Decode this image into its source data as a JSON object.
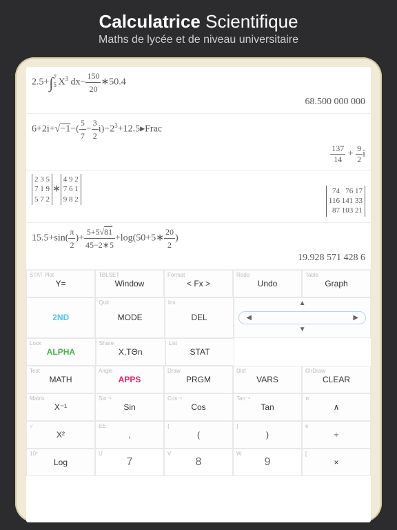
{
  "header": {
    "title_bold": "Calculatrice",
    "title_rest": "Scientifique",
    "subtitle": "Maths de lycée et de niveau universitaire"
  },
  "history": [
    {
      "expr": "2.5+∫₅⁷ X³ dx − 150/20 ∗ 50.4",
      "result": "68.500 000 000"
    },
    {
      "expr": "6+2i+√−1−(5/7 − 3/2 i)−2³+12.5▸Frac",
      "result": "137/14 + 9/2 i"
    },
    {
      "expr": "[2 3 5; 7 1 9; 5 7 2] ∗ [4 9 2; 7 6 1; 9 8 2]",
      "result": "[74 76 17; 116 141 33; 87 103 21]"
    },
    {
      "expr": "15.5+sin(π/2)+ (5+5√81)/(45−2∗5) +log(50+5∗20/2)",
      "result": "19.928 571 428 6"
    }
  ],
  "keys": {
    "r1": [
      {
        "sec": "STAT Plot",
        "main": "Y="
      },
      {
        "sec": "TBLSET",
        "main": "Window"
      },
      {
        "sec": "Format",
        "main": "< Fx >"
      },
      {
        "sec": "Redo",
        "main": "Undo"
      },
      {
        "sec": "Table",
        "main": "Graph"
      }
    ],
    "r2": [
      {
        "sec": "",
        "main": "2ND"
      },
      {
        "sec": "Quit",
        "main": "MODE"
      },
      {
        "sec": "Ins",
        "main": "DEL"
      }
    ],
    "dpad": {
      "up": "▲",
      "down": "▼",
      "left": "◀",
      "right": "▶"
    },
    "r3": [
      {
        "sec": "Lock",
        "main": "ALPHA"
      },
      {
        "sec": "Share",
        "main": "X,TΘn"
      },
      {
        "sec": "List",
        "main": "STAT"
      }
    ],
    "r4": [
      {
        "sec": "Test",
        "main": "MATH"
      },
      {
        "sec": "Angle",
        "main": "APPS"
      },
      {
        "sec": "Draw",
        "main": "PRGM"
      },
      {
        "sec": "Dist",
        "main": "VARS"
      },
      {
        "sec": "ClrDraw",
        "main": "CLEAR"
      }
    ],
    "r5": [
      {
        "sec": "Matrix",
        "main": "X⁻¹"
      },
      {
        "sec": "Sin⁻¹",
        "main": "Sin"
      },
      {
        "sec": "Cos⁻¹",
        "main": "Cos"
      },
      {
        "sec": "Tan⁻¹",
        "main": "Tan"
      },
      {
        "sec": "π",
        "main": "∧"
      }
    ],
    "r6": [
      {
        "sec": "√",
        "main": "X²"
      },
      {
        "sec": "EE",
        "main": ","
      },
      {
        "sec": "{",
        "main": "("
      },
      {
        "sec": "}",
        "main": ")"
      },
      {
        "sec": "e",
        "main": "÷"
      }
    ],
    "r7": [
      {
        "sec": "10ˣ",
        "main": "Log"
      },
      {
        "sec": "U",
        "main": "7"
      },
      {
        "sec": "V",
        "main": "8"
      },
      {
        "sec": "W",
        "main": "9"
      },
      {
        "sec": "[",
        "main": "×"
      }
    ]
  }
}
